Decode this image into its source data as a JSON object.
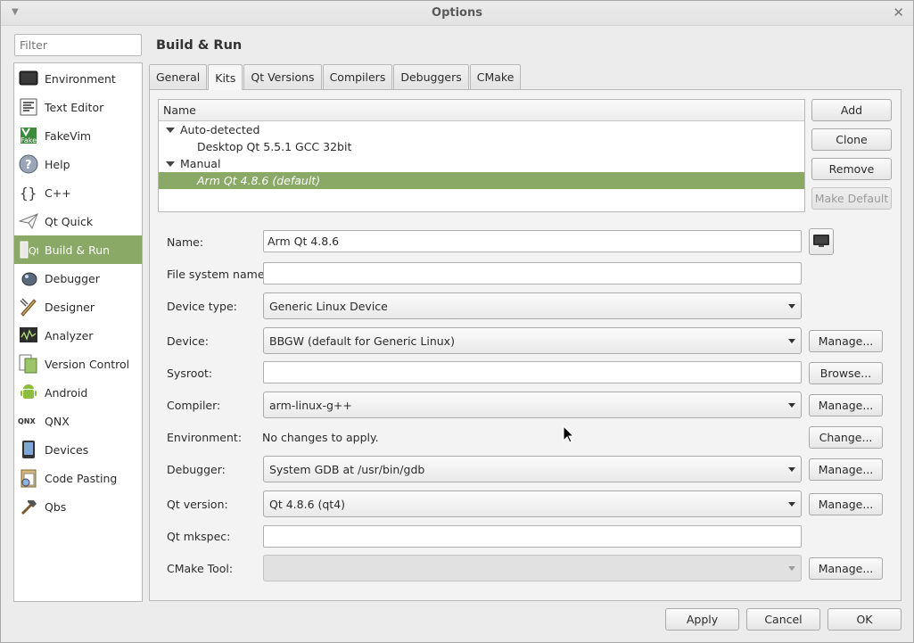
{
  "window": {
    "title": "Options"
  },
  "filter": {
    "placeholder": "Filter"
  },
  "sidebar": {
    "items": [
      {
        "label": "Environment",
        "icon": "monitor-icon"
      },
      {
        "label": "Text Editor",
        "icon": "text-editor-icon"
      },
      {
        "label": "FakeVim",
        "icon": "fakevim-icon"
      },
      {
        "label": "Help",
        "icon": "help-icon"
      },
      {
        "label": "C++",
        "icon": "braces-icon"
      },
      {
        "label": "Qt Quick",
        "icon": "paper-plane-icon"
      },
      {
        "label": "Build & Run",
        "icon": "build-run-icon",
        "selected": true
      },
      {
        "label": "Debugger",
        "icon": "bug-icon"
      },
      {
        "label": "Designer",
        "icon": "designer-icon"
      },
      {
        "label": "Analyzer",
        "icon": "analyzer-icon"
      },
      {
        "label": "Version Control",
        "icon": "version-control-icon"
      },
      {
        "label": "Android",
        "icon": "android-icon"
      },
      {
        "label": "QNX",
        "icon": "qnx-icon"
      },
      {
        "label": "Devices",
        "icon": "device-icon"
      },
      {
        "label": "Code Pasting",
        "icon": "code-pasting-icon"
      },
      {
        "label": "Qbs",
        "icon": "hammer-icon"
      }
    ]
  },
  "page": {
    "title": "Build & Run"
  },
  "tabs": [
    "General",
    "Kits",
    "Qt Versions",
    "Compilers",
    "Debuggers",
    "CMake"
  ],
  "active_tab": "Kits",
  "kits_tree": {
    "header": "Name",
    "groups": [
      {
        "label": "Auto-detected",
        "children": [
          "Desktop Qt 5.5.1 GCC 32bit"
        ]
      },
      {
        "label": "Manual",
        "children": [
          "Arm Qt 4.8.6 (default)"
        ]
      }
    ],
    "selected": "Arm Qt 4.8.6 (default)"
  },
  "kit_buttons": {
    "add": "Add",
    "clone": "Clone",
    "remove": "Remove",
    "make_default": "Make Default"
  },
  "form": {
    "name_label": "Name:",
    "name_value": "Arm Qt 4.8.6",
    "fs_name_label": "File system name:",
    "fs_name_value": "",
    "device_type_label": "Device type:",
    "device_type_value": "Generic Linux Device",
    "device_label": "Device:",
    "device_value": "BBGW (default for Generic Linux)",
    "sysroot_label": "Sysroot:",
    "sysroot_value": "",
    "compiler_label": "Compiler:",
    "compiler_value": "arm-linux-g++",
    "environment_label": "Environment:",
    "environment_value": "No changes to apply.",
    "debugger_label": "Debugger:",
    "debugger_value": "System GDB at /usr/bin/gdb",
    "qt_version_label": "Qt version:",
    "qt_version_value": "Qt 4.8.6 (qt4)",
    "qt_mkspec_label": "Qt mkspec:",
    "qt_mkspec_value": "",
    "cmake_tool_label": "CMake Tool:",
    "cmake_tool_value": ""
  },
  "side_buttons": {
    "manage": "Manage...",
    "browse": "Browse...",
    "change": "Change..."
  },
  "dialog_buttons": {
    "apply": "Apply",
    "cancel": "Cancel",
    "ok": "OK"
  },
  "colors": {
    "selection": "#8aa866",
    "background": "#ececec"
  }
}
